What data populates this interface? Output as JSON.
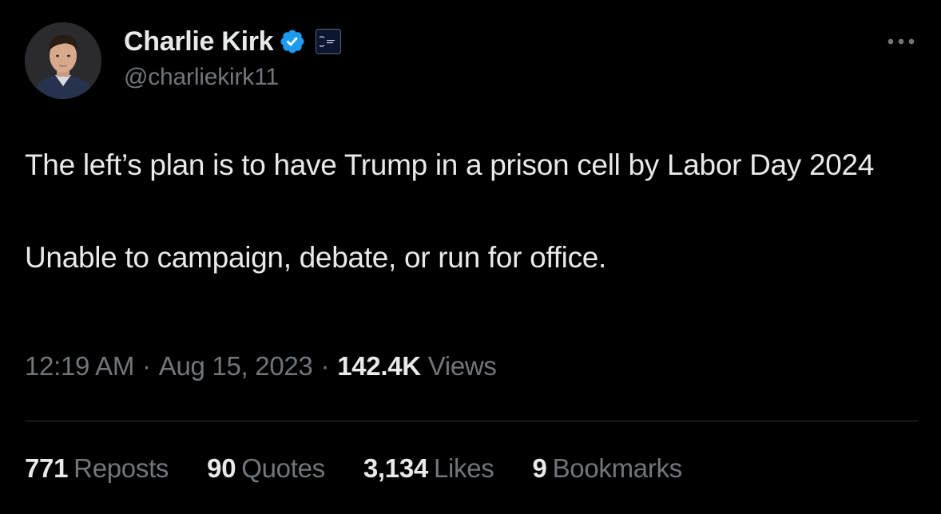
{
  "author": {
    "display_name": "Charlie Kirk",
    "handle": "@charliekirk11",
    "verified_icon": "verified-badge-icon",
    "affiliation_icon": "affiliation-badge-icon"
  },
  "tweet": {
    "line1": "The left’s plan is to have Trump in a prison cell by Labor Day 2024",
    "line2": "Unable to campaign, debate, or run for office."
  },
  "meta": {
    "time": "12:19 AM",
    "separator": "·",
    "date": "Aug 15, 2023",
    "views_count": "142.4K",
    "views_label": "Views"
  },
  "stats": [
    {
      "count": "771",
      "label": "Reposts"
    },
    {
      "count": "90",
      "label": "Quotes"
    },
    {
      "count": "3,134",
      "label": "Likes"
    },
    {
      "count": "9",
      "label": "Bookmarks"
    }
  ],
  "colors": {
    "background": "#000000",
    "primary_text": "#e7e9ea",
    "secondary_text": "#71767b",
    "verified_blue": "#1d9bf0",
    "divider": "#2f3336"
  }
}
